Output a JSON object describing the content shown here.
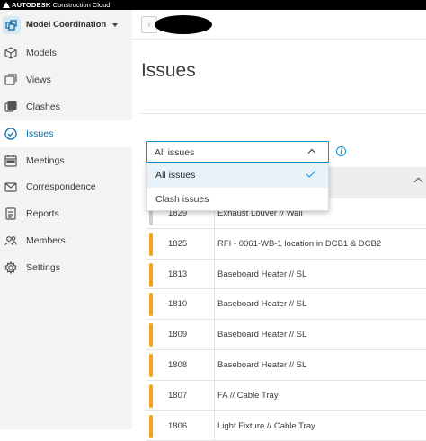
{
  "topbar": {
    "brand": "AUTODESK",
    "product": "Construction Cloud"
  },
  "project": {
    "name": "Model Coordination"
  },
  "nav": [
    {
      "label": "Models",
      "icon": "cube-icon",
      "active": false
    },
    {
      "label": "Views",
      "icon": "views-icon",
      "active": false
    },
    {
      "label": "Clashes",
      "icon": "clashes-icon",
      "active": false
    },
    {
      "label": "Issues",
      "icon": "check-circle-icon",
      "active": true
    },
    {
      "label": "Meetings",
      "icon": "calendar-icon",
      "active": false
    },
    {
      "label": "Correspondence",
      "icon": "mail-icon",
      "active": false
    },
    {
      "label": "Reports",
      "icon": "report-icon",
      "active": false
    },
    {
      "label": "Members",
      "icon": "members-icon",
      "active": false
    },
    {
      "label": "Settings",
      "icon": "gear-icon",
      "active": false
    }
  ],
  "page": {
    "title": "Issues"
  },
  "filter": {
    "selected": "All issues",
    "options": [
      {
        "label": "All issues",
        "selected": true
      },
      {
        "label": "Clash issues",
        "selected": false
      }
    ]
  },
  "issues": [
    {
      "id": "1829",
      "title": "Exhaust Louver // Wall",
      "status_color": "#cfcfcf"
    },
    {
      "id": "1825",
      "title": "RFI - 0061-WB-1 location in DCB1 & DCB2",
      "status_color": "#f2a51a"
    },
    {
      "id": "1813",
      "title": "Baseboard Heater // SL",
      "status_color": "#f2a51a"
    },
    {
      "id": "1810",
      "title": "Baseboard Heater // SL",
      "status_color": "#f2a51a"
    },
    {
      "id": "1809",
      "title": "Baseboard Heater // SL",
      "status_color": "#f2a51a"
    },
    {
      "id": "1808",
      "title": "Baseboard Heater // SL",
      "status_color": "#f2a51a"
    },
    {
      "id": "1807",
      "title": "FA // Cable Tray",
      "status_color": "#f2a51a"
    },
    {
      "id": "1806",
      "title": "Light Fixture // Cable Tray",
      "status_color": "#f2a51a"
    }
  ],
  "colors": {
    "accent": "#0696d7",
    "active_nav": "#0c6da8",
    "status_open": "#f2a51a"
  }
}
